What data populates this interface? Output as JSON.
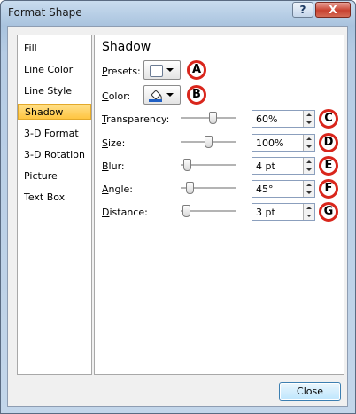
{
  "window": {
    "title": "Format Shape",
    "help_glyph": "?",
    "close_glyph": "X"
  },
  "nav": {
    "items": [
      {
        "label": "Fill"
      },
      {
        "label": "Line Color"
      },
      {
        "label": "Line Style"
      },
      {
        "label": "Shadow",
        "selected": true
      },
      {
        "label": "3-D Format"
      },
      {
        "label": "3-D Rotation"
      },
      {
        "label": "Picture"
      },
      {
        "label": "Text Box"
      }
    ]
  },
  "panel": {
    "title": "Shadow",
    "presets": {
      "label_u": "P",
      "label_rest": "resets:",
      "callout": "A"
    },
    "color": {
      "label_u": "C",
      "label_rest": "olor:",
      "callout": "B"
    },
    "rows": [
      {
        "label_u": "T",
        "label_rest": "ransparency:",
        "value": "60%",
        "slider_level": 0.6,
        "callout": "C"
      },
      {
        "label_u": "S",
        "label_rest": "ize:",
        "value": "100%",
        "slider_level": 0.5,
        "callout": "D"
      },
      {
        "label_u": "B",
        "label_rest": "lur:",
        "value": "4 pt",
        "slider_level": 0.06,
        "callout": "E"
      },
      {
        "label_u": "A",
        "label_rest": "ngle:",
        "value": "45°",
        "slider_level": 0.12,
        "callout": "F"
      },
      {
        "label_u": "D",
        "label_rest": "istance:",
        "value": "3 pt",
        "slider_level": 0.03,
        "callout": "G"
      }
    ]
  },
  "footer": {
    "close_label": "Close"
  },
  "colors": {
    "selection": "#ffc541",
    "callout_ring": "#d9261c",
    "paint_fill": "#1f5fc4"
  }
}
